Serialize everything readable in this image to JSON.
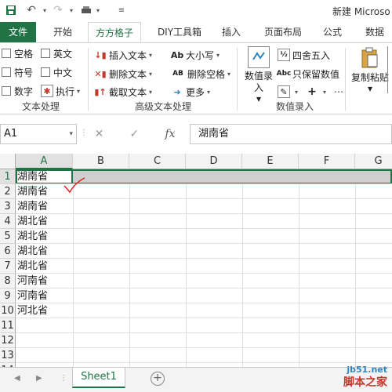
{
  "window": {
    "title": "新建 Microso"
  },
  "tabs": [
    {
      "label": "文件"
    },
    {
      "label": "开始"
    },
    {
      "label": "方方格子"
    },
    {
      "label": "DIY工具箱"
    },
    {
      "label": "插入"
    },
    {
      "label": "页面布局"
    },
    {
      "label": "公式"
    },
    {
      "label": "数据"
    }
  ],
  "ribbon": {
    "text_group": {
      "label": "文本处理",
      "items": [
        "空格",
        "英文",
        "符号",
        "中文",
        "数字",
        "执行"
      ]
    },
    "adv_group": {
      "label": "高级文本处理",
      "items": [
        "插入文本",
        "删除文本",
        "截取文本",
        "大小写",
        "删除空格",
        "更多"
      ]
    },
    "num_group": {
      "label": "数值录入",
      "big_button": "数值录入",
      "items": [
        "四舍五入",
        "只保留数值"
      ]
    },
    "paste": {
      "label": "复制粘贴"
    }
  },
  "formula_bar": {
    "name_box": "A1",
    "fx": "fx",
    "value": "湖南省"
  },
  "columns": [
    "A",
    "B",
    "C",
    "D",
    "E",
    "F",
    "G"
  ],
  "rows": [
    "1",
    "2",
    "3",
    "4",
    "5",
    "6",
    "7",
    "8",
    "9",
    "10",
    "11",
    "12",
    "13",
    "14"
  ],
  "cells": [
    "湖南省",
    "湖南省",
    "湖南省",
    "湖北省",
    "湖北省",
    "湖北省",
    "湖北省",
    "河南省",
    "河南省",
    "河北省"
  ],
  "sheets": [
    {
      "name": "Sheet1"
    }
  ],
  "watermark": {
    "line1": "jb51.net",
    "line2": "脚本之家"
  }
}
